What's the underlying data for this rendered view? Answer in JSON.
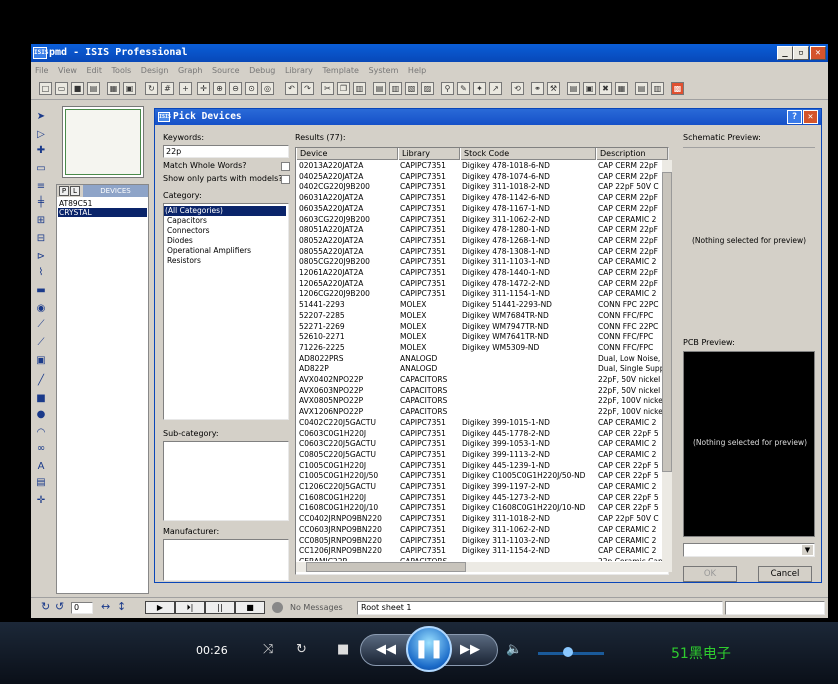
{
  "app": {
    "title": "pmd - ISIS Professional",
    "logo": "ISIS",
    "window_buttons": {
      "min": "_",
      "max": "▫",
      "close": "✕"
    },
    "menu": [
      "File",
      "View",
      "Edit",
      "Tools",
      "Design",
      "Graph",
      "Source",
      "Debug",
      "Library",
      "Template",
      "System",
      "Help"
    ]
  },
  "device_panel": {
    "p_label": "P",
    "l_label": "L",
    "header": "DEVICES",
    "items": [
      "AT89C51",
      "CRYSTAL"
    ]
  },
  "statusbar": {
    "messages": "No Messages",
    "sheet": "Root sheet 1",
    "rotate_value": "0"
  },
  "dialog": {
    "title": "Pick Devices",
    "help": "?",
    "close": "✕",
    "keywords_label": "Keywords:",
    "keywords_value": "22p",
    "match_whole": "Match Whole Words?",
    "show_models": "Show only parts with models?",
    "category_label": "Category:",
    "categories": [
      "(All Categories)",
      "Capacitors",
      "Connectors",
      "Diodes",
      "Operational Amplifiers",
      "Resistors"
    ],
    "subcategory_label": "Sub-category:",
    "manufacturer_label": "Manufacturer:",
    "results_label": "Results (77):",
    "columns": [
      "Device",
      "Library",
      "Stock Code",
      "Description"
    ],
    "rows": [
      [
        "02013A220JAT2A",
        "CAPIPC7351",
        "Digikey 478-1018-6-ND",
        "CAP CERM 22pF"
      ],
      [
        "04025A220JAT2A",
        "CAPIPC7351",
        "Digikey 478-1074-6-ND",
        "CAP CERM 22pF"
      ],
      [
        "0402CG220J9B200",
        "CAPIPC7351",
        "Digikey 311-1018-2-ND",
        "CAP 22pF 50V C"
      ],
      [
        "06031A220JAT2A",
        "CAPIPC7351",
        "Digikey 478-1142-6-ND",
        "CAP CERM 22pF"
      ],
      [
        "06035A220JAT2A",
        "CAPIPC7351",
        "Digikey 478-1167-1-ND",
        "CAP CERM 22pF"
      ],
      [
        "0603CG220J9B200",
        "CAPIPC7351",
        "Digikey 311-1062-2-ND",
        "CAP CERAMIC 2"
      ],
      [
        "08051A220JAT2A",
        "CAPIPC7351",
        "Digikey 478-1280-1-ND",
        "CAP CERM 22pF"
      ],
      [
        "08052A220JAT2A",
        "CAPIPC7351",
        "Digikey 478-1268-1-ND",
        "CAP CERM 22pF"
      ],
      [
        "08055A220JAT2A",
        "CAPIPC7351",
        "Digikey 478-1308-1-ND",
        "CAP CERM 22pF"
      ],
      [
        "0805CG220J9B200",
        "CAPIPC7351",
        "Digikey 311-1103-1-ND",
        "CAP CERAMIC 2"
      ],
      [
        "12061A220JAT2A",
        "CAPIPC7351",
        "Digikey 478-1440-1-ND",
        "CAP CERM 22pF"
      ],
      [
        "12065A220JAT2A",
        "CAPIPC7351",
        "Digikey 478-1472-2-ND",
        "CAP CERM 22pF"
      ],
      [
        "1206CG220J9B200",
        "CAPIPC7351",
        "Digikey 311-1154-1-ND",
        "CAP CERAMIC 2"
      ],
      [
        "51441-2293",
        "MOLEX",
        "Digikey 51441-2293-ND",
        "CONN FPC 22PC"
      ],
      [
        "52207-2285",
        "MOLEX",
        "Digikey WM7684TR-ND",
        "CONN FFC/FPC"
      ],
      [
        "52271-2269",
        "MOLEX",
        "Digikey WM7947TR-ND",
        "CONN FFC 22PC"
      ],
      [
        "52610-2271",
        "MOLEX",
        "Digikey WM7641TR-ND",
        "CONN FFC/FPC"
      ],
      [
        "71226-2225",
        "MOLEX",
        "Digikey WM5309-ND",
        "CONN FFC/FPC"
      ],
      [
        "AD8022PRS",
        "ANALOGD",
        "",
        "Dual, Low Noise,"
      ],
      [
        "AD822P",
        "ANALOGD",
        "",
        "Dual, Single Supp"
      ],
      [
        "AVX0402NPO22P",
        "CAPACITORS",
        "",
        "22pF, 50V nickel"
      ],
      [
        "AVX0603NPO22P",
        "CAPACITORS",
        "",
        "22pF, 50V nickel"
      ],
      [
        "AVX0805NPO22P",
        "CAPACITORS",
        "",
        "22pF, 100V nicke"
      ],
      [
        "AVX1206NPO22P",
        "CAPACITORS",
        "",
        "22pF, 100V nicke"
      ],
      [
        "C0402C220J5GACTU",
        "CAPIPC7351",
        "Digikey 399-1015-1-ND",
        "CAP CERAMIC 2"
      ],
      [
        "C0603C0G1H220J",
        "CAPIPC7351",
        "Digikey 445-1778-2-ND",
        "CAP CER 22pF 5"
      ],
      [
        "C0603C220J5GACTU",
        "CAPIPC7351",
        "Digikey 399-1053-1-ND",
        "CAP CERAMIC 2"
      ],
      [
        "C0805C220J5GACTU",
        "CAPIPC7351",
        "Digikey 399-1113-2-ND",
        "CAP CERAMIC 2"
      ],
      [
        "C1005C0G1H220J",
        "CAPIPC7351",
        "Digikey 445-1239-1-ND",
        "CAP CER 22pF 5"
      ],
      [
        "C1005C0G1H220J/50",
        "CAPIPC7351",
        "Digikey C1005C0G1H220J/50-ND",
        "CAP CER 22pF 5"
      ],
      [
        "C1206C220J5GACTU",
        "CAPIPC7351",
        "Digikey 399-1197-2-ND",
        "CAP CERAMIC 2"
      ],
      [
        "C1608C0G1H220J",
        "CAPIPC7351",
        "Digikey 445-1273-2-ND",
        "CAP CER 22pF 5"
      ],
      [
        "C1608C0G1H220J/10",
        "CAPIPC7351",
        "Digikey C1608C0G1H220J/10-ND",
        "CAP CER 22pF 5"
      ],
      [
        "CC0402JRNPO9BN220",
        "CAPIPC7351",
        "Digikey 311-1018-2-ND",
        "CAP 22pF 50V C"
      ],
      [
        "CC0603JRNPO9BN220",
        "CAPIPC7351",
        "Digikey 311-1062-2-ND",
        "CAP CERAMIC 2"
      ],
      [
        "CC0805JRNPO9BN220",
        "CAPIPC7351",
        "Digikey 311-1103-2-ND",
        "CAP CERAMIC 2"
      ],
      [
        "CC1206JRNPO9BN220",
        "CAPIPC7351",
        "Digikey 311-1154-2-ND",
        "CAP CERAMIC 2"
      ],
      [
        "CERAMIC22P",
        "CAPACITORS",
        "",
        "22p Ceramic Cap"
      ]
    ],
    "schematic_label": "Schematic Preview:",
    "schematic_empty": "(Nothing selected for preview)",
    "pcb_label": "PCB Preview:",
    "pcb_empty": "(Nothing selected for preview)",
    "ok": "OK",
    "cancel": "Cancel"
  },
  "player": {
    "time": "00:26",
    "brand": "51黑电子",
    "volume_level": 0.45
  }
}
